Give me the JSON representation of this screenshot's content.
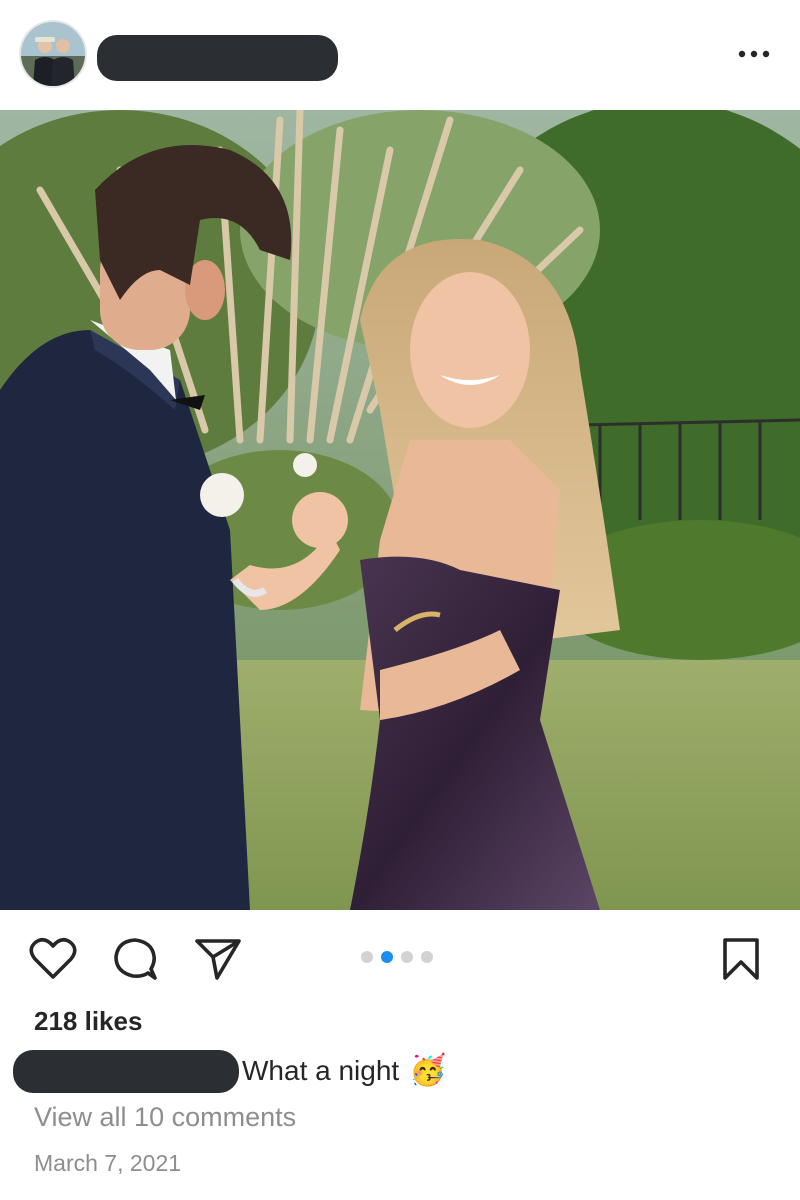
{
  "post": {
    "more_icon": "more-horizontal-icon",
    "photo": {
      "carousel_count": 4,
      "active_index": 1
    },
    "actions": {
      "like_icon": "heart-icon",
      "comment_icon": "comment-bubble-icon",
      "share_icon": "paper-plane-icon",
      "save_icon": "bookmark-icon"
    },
    "likes_text": "218 likes",
    "caption_text": "What a night",
    "caption_emoji": "🥳",
    "view_comments_text": "View all 10 comments",
    "date_text": "March 7, 2021"
  },
  "colors": {
    "text": "#262626",
    "muted": "#8e8e8e",
    "accent": "#1b8ef0",
    "redaction": "#2b2f33"
  }
}
